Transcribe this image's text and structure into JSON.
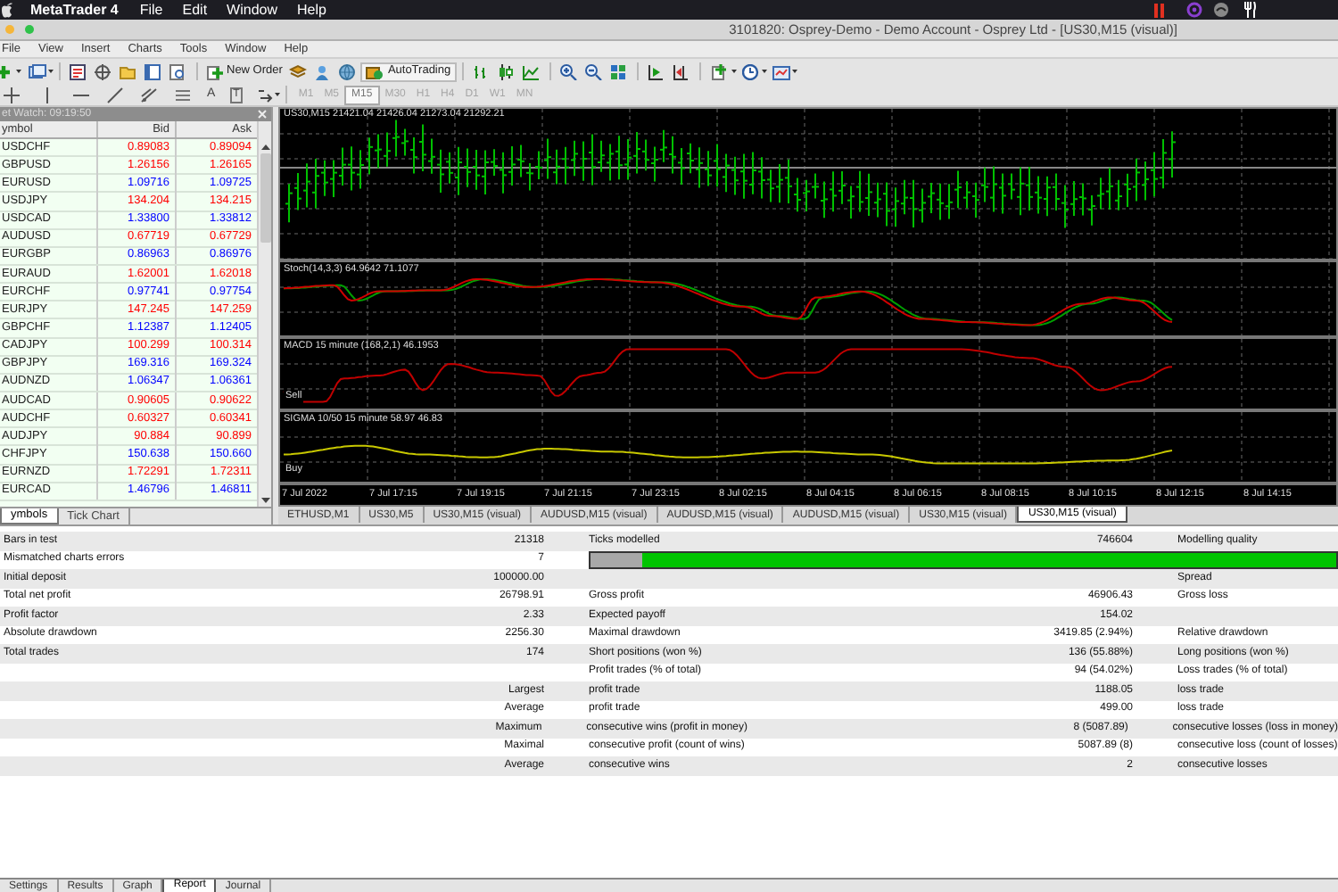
{
  "mac_menu": {
    "app": "MetaTrader 4",
    "items": [
      "File",
      "Edit",
      "Window",
      "Help"
    ]
  },
  "window": {
    "title": "3101820: Osprey-Demo - Demo Account - Osprey Ltd - [US30,M15 (visual)]"
  },
  "menu": [
    "File",
    "View",
    "Insert",
    "Charts",
    "Tools",
    "Window",
    "Help"
  ],
  "toolbar": {
    "new_order": "New Order",
    "auto_trading": "AutoTrading"
  },
  "drawing_toolbar": {
    "text_tools": [
      "A",
      "T"
    ],
    "timeframes": [
      {
        "label": "M1",
        "selected": false
      },
      {
        "label": "M5",
        "selected": false
      },
      {
        "label": "M15",
        "selected": true
      },
      {
        "label": "M30",
        "selected": false
      },
      {
        "label": "H1",
        "selected": false
      },
      {
        "label": "H4",
        "selected": false
      },
      {
        "label": "D1",
        "selected": false
      },
      {
        "label": "W1",
        "selected": false
      },
      {
        "label": "MN",
        "selected": false
      }
    ]
  },
  "market_watch": {
    "title": "et Watch: 09:19:50",
    "columns": [
      "ymbol",
      "Bid",
      "Ask"
    ],
    "rows": [
      {
        "symbol": "USDCHF",
        "bid": "0.89083",
        "ask": "0.89094",
        "color": "#ff0000"
      },
      {
        "symbol": "GBPUSD",
        "bid": "1.26156",
        "ask": "1.26165",
        "color": "#ff0000"
      },
      {
        "symbol": "EURUSD",
        "bid": "1.09716",
        "ask": "1.09725",
        "color": "#0000ff"
      },
      {
        "symbol": "USDJPY",
        "bid": "134.204",
        "ask": "134.215",
        "color": "#ff0000"
      },
      {
        "symbol": "USDCAD",
        "bid": "1.33800",
        "ask": "1.33812",
        "color": "#0000ff"
      },
      {
        "symbol": "AUDUSD",
        "bid": "0.67719",
        "ask": "0.67729",
        "color": "#ff0000"
      },
      {
        "symbol": "EURGBP",
        "bid": "0.86963",
        "ask": "0.86976",
        "color": "#0000ff"
      },
      {
        "symbol": "EURAUD",
        "bid": "1.62001",
        "ask": "1.62018",
        "color": "#ff0000"
      },
      {
        "symbol": "EURCHF",
        "bid": "0.97741",
        "ask": "0.97754",
        "color": "#0000ff"
      },
      {
        "symbol": "EURJPY",
        "bid": "147.245",
        "ask": "147.259",
        "color": "#ff0000"
      },
      {
        "symbol": "GBPCHF",
        "bid": "1.12387",
        "ask": "1.12405",
        "color": "#0000ff"
      },
      {
        "symbol": "CADJPY",
        "bid": "100.299",
        "ask": "100.314",
        "color": "#ff0000"
      },
      {
        "symbol": "GBPJPY",
        "bid": "169.316",
        "ask": "169.324",
        "color": "#0000ff"
      },
      {
        "symbol": "AUDNZD",
        "bid": "1.06347",
        "ask": "1.06361",
        "color": "#0000ff"
      },
      {
        "symbol": "AUDCAD",
        "bid": "0.90605",
        "ask": "0.90622",
        "color": "#ff0000"
      },
      {
        "symbol": "AUDCHF",
        "bid": "0.60327",
        "ask": "0.60341",
        "color": "#ff0000"
      },
      {
        "symbol": "AUDJPY",
        "bid": "90.884",
        "ask": "90.899",
        "color": "#ff0000"
      },
      {
        "symbol": "CHFJPY",
        "bid": "150.638",
        "ask": "150.660",
        "color": "#0000ff"
      },
      {
        "symbol": "EURNZD",
        "bid": "1.72291",
        "ask": "1.72311",
        "color": "#ff0000"
      },
      {
        "symbol": "EURCAD",
        "bid": "1.46796",
        "ask": "1.46811",
        "color": "#0000ff"
      }
    ],
    "tabs": [
      {
        "label": "ymbols",
        "selected": true
      },
      {
        "label": "Tick Chart",
        "selected": false
      }
    ]
  },
  "chart": {
    "title": "US30,M15  21421.04 21426.04 21273.04 21292.21",
    "panes": [
      {
        "kind": "stoch",
        "title": "Stoch(14,3,3) 64.9642 71.1077"
      },
      {
        "kind": "macd",
        "title": "MACD 15 minute (168,2,1) 46.1953",
        "level_label": "Sell"
      },
      {
        "kind": "sigma",
        "title": "SIGMA 10/50 15 minute 58.97 46.83",
        "level_label": "Buy"
      }
    ],
    "time_labels": [
      "7 Jul 2022",
      "7 Jul 17:15",
      "7 Jul 19:15",
      "7 Jul 21:15",
      "7 Jul 23:15",
      "8 Jul 02:15",
      "8 Jul 04:15",
      "8 Jul 06:15",
      "8 Jul 08:15",
      "8 Jul 10:15",
      "8 Jul 12:15",
      "8 Jul 14:15"
    ],
    "tabs": [
      {
        "label": "ETHUSD,M1",
        "selected": false
      },
      {
        "label": "US30,M5",
        "selected": false
      },
      {
        "label": "US30,M15 (visual)",
        "selected": false
      },
      {
        "label": "AUDUSD,M15 (visual)",
        "selected": false
      },
      {
        "label": "AUDUSD,M15 (visual)",
        "selected": false
      },
      {
        "label": "AUDUSD,M15 (visual)",
        "selected": false
      },
      {
        "label": "US30,M15 (visual)",
        "selected": false
      },
      {
        "label": "US30,M15 (visual)",
        "selected": true
      }
    ]
  },
  "report": {
    "rows": [
      {
        "column_1": "Bars in test",
        "column_2": "21318",
        "column_3": "Ticks modelled",
        "column_4": "746604",
        "column_5": "Modelling quality"
      },
      {
        "column_1": "Mismatched charts errors",
        "column_2": "7",
        "quality_bar": {
          "level": 0.93
        }
      },
      {
        "column_1": "Initial deposit",
        "column_2": "100000.00",
        "column_5": "Spread"
      },
      {
        "column_1": "Total net profit",
        "column_2": "26798.91",
        "column_3": "Gross profit",
        "column_4": "46906.43",
        "column_5": "Gross loss"
      },
      {
        "column_1": "Profit factor",
        "column_2": "2.33",
        "column_3": "Expected payoff",
        "column_4": "154.02"
      },
      {
        "column_1": "Absolute drawdown",
        "column_2": "2256.30",
        "column_3": "Maximal drawdown",
        "column_4": "3419.85 (2.94%)",
        "column_5": "Relative drawdown"
      },
      {
        "column_1": "Total trades",
        "column_2": "174",
        "column_3": "Short positions (won %)",
        "column_4": "136 (55.88%)",
        "column_5": "Long positions (won %)"
      },
      {
        "column_3": "Profit trades (% of total)",
        "column_4": "94 (54.02%)",
        "column_5": "Loss trades (% of total)"
      },
      {
        "column_2": "Largest",
        "column_3": "profit trade",
        "column_4": "1188.05",
        "column_5": "loss trade"
      },
      {
        "column_2": "Average",
        "column_3": "profit trade",
        "column_4": "499.00",
        "column_5": "loss trade"
      },
      {
        "column_2": "Maximum",
        "column_3": "consecutive wins (profit in money)",
        "column_4": "8 (5087.89)",
        "column_5": "consecutive losses (loss in money)"
      },
      {
        "column_2": "Maximal",
        "column_3": "consecutive profit (count of wins)",
        "column_4": "5087.89 (8)",
        "column_5": "consecutive loss (count of losses)"
      },
      {
        "column_2": "Average",
        "column_3": "consecutive wins",
        "column_4": "2",
        "column_5": "consecutive losses"
      }
    ]
  },
  "bottom_tabs": [
    {
      "label": "Settings",
      "selected": false
    },
    {
      "label": "Results",
      "selected": false
    },
    {
      "label": "Graph",
      "selected": false
    },
    {
      "label": "Report",
      "selected": true
    },
    {
      "label": "Journal",
      "selected": false
    }
  ]
}
